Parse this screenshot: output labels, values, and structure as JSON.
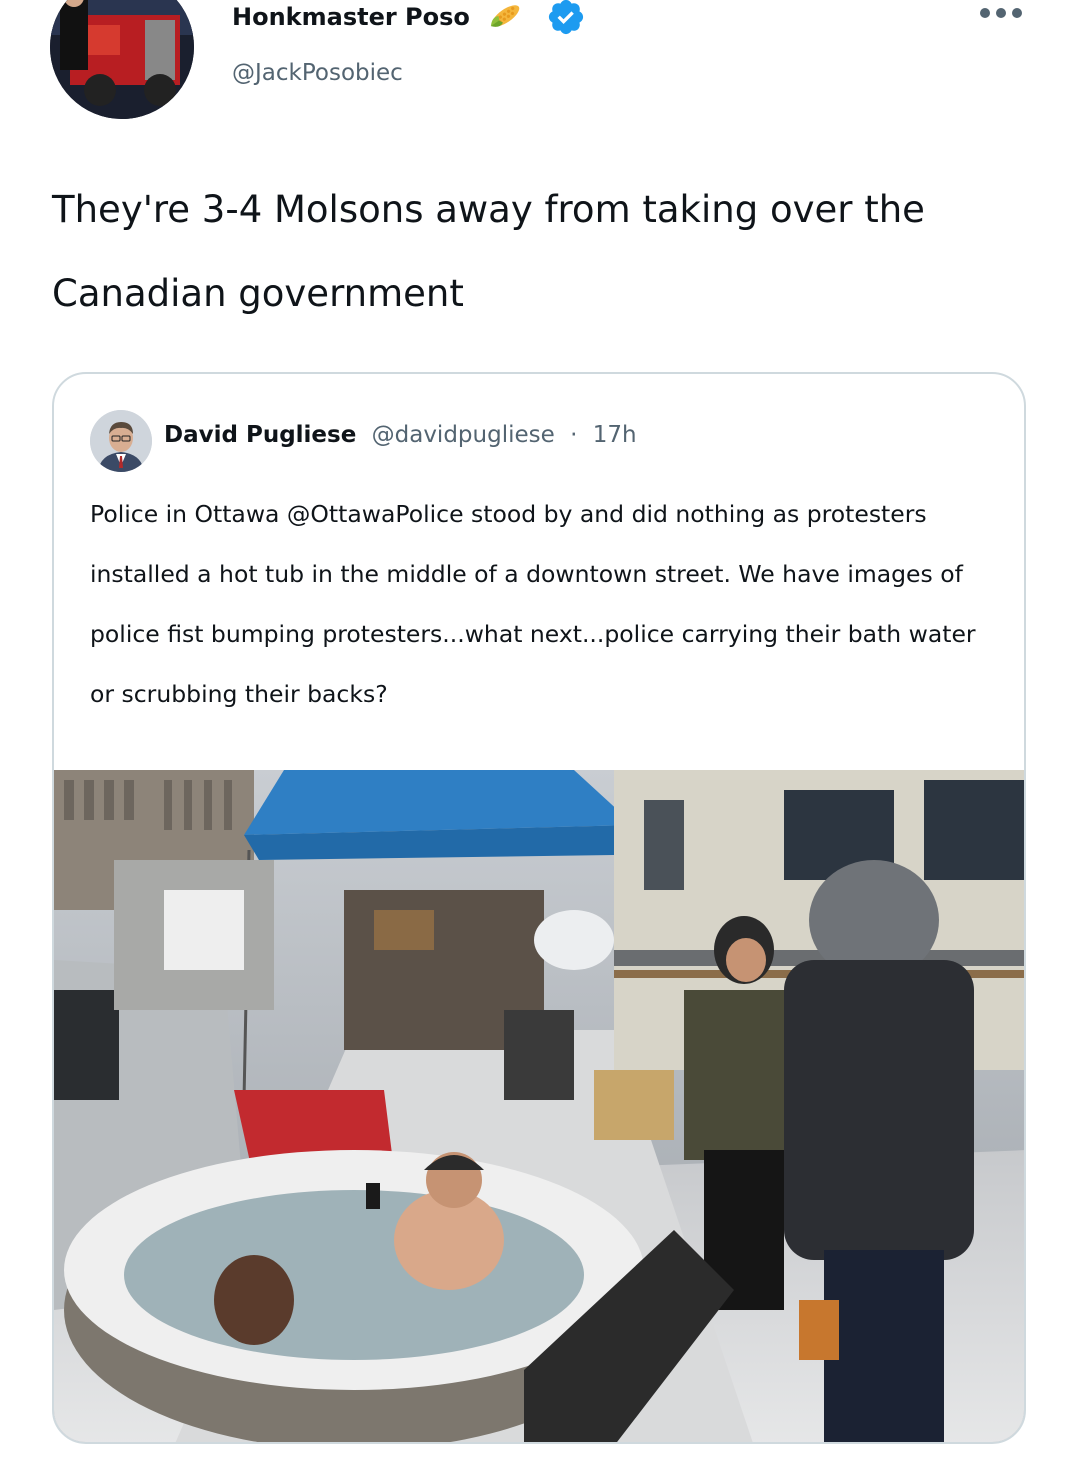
{
  "author": {
    "display_name": "Honkmaster Poso",
    "handle": "@JackPosobiec",
    "verified": true,
    "name_emoji": "corn-icon"
  },
  "tweet": {
    "text": "They're 3-4 Molsons away from taking over the Canadian government"
  },
  "quoted": {
    "display_name": "David Pugliese",
    "handle": "@davidpugliese",
    "separator": "·",
    "time": "17h",
    "text": "Police in Ottawa @OttawaPolice stood by and did nothing as protesters installed a hot tub in the middle of a downtown street. We have images of police fist bumping protesters...what next...police carrying their bath water or scrubbing their backs?"
  },
  "colors": {
    "text_primary": "#0f1419",
    "text_secondary": "#536471",
    "verified_blue": "#1d9bf0",
    "border": "#cfd9de",
    "tent_blue": "#2f7fc4"
  }
}
